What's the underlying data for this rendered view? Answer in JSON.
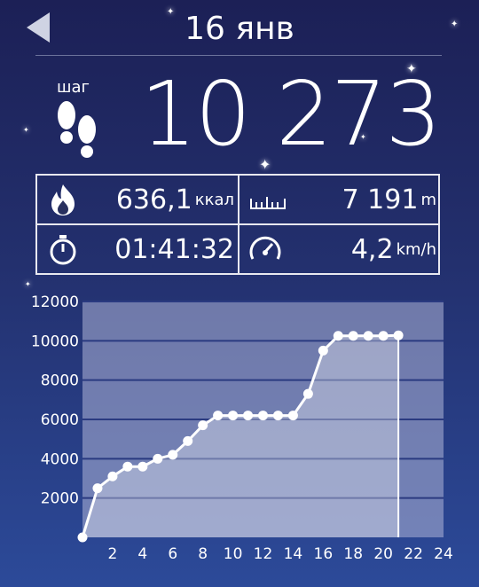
{
  "header": {
    "date": "16 янв",
    "back_icon": "back-arrow-icon"
  },
  "steps": {
    "label": "шаг",
    "value": "10 273",
    "icon": "footprints-icon"
  },
  "stats": {
    "calories": {
      "value": "636,1",
      "unit": "ккал",
      "icon": "flame-icon"
    },
    "distance": {
      "value": "7 191",
      "unit": "m",
      "icon": "ruler-icon"
    },
    "duration": {
      "value": "01:41:32",
      "icon": "stopwatch-icon"
    },
    "speed": {
      "value": "4,2",
      "unit": "km/h",
      "icon": "speedometer-icon"
    }
  },
  "chart_data": {
    "type": "area",
    "x": [
      0,
      1,
      2,
      3,
      4,
      5,
      6,
      7,
      8,
      9,
      10,
      11,
      12,
      13,
      14,
      15,
      16,
      17,
      18,
      19,
      20,
      21
    ],
    "values": [
      0,
      2500,
      3100,
      3600,
      3600,
      4000,
      4200,
      4900,
      5700,
      6200,
      6200,
      6200,
      6200,
      6200,
      6200,
      7300,
      9500,
      10250,
      10250,
      10250,
      10250,
      10273
    ],
    "xticks": [
      2,
      4,
      6,
      8,
      10,
      12,
      14,
      16,
      18,
      20,
      22,
      24
    ],
    "yticks": [
      2000,
      4000,
      6000,
      8000,
      10000,
      12000
    ],
    "xlim": [
      0,
      24
    ],
    "ylim": [
      0,
      12000
    ],
    "grid": true
  }
}
